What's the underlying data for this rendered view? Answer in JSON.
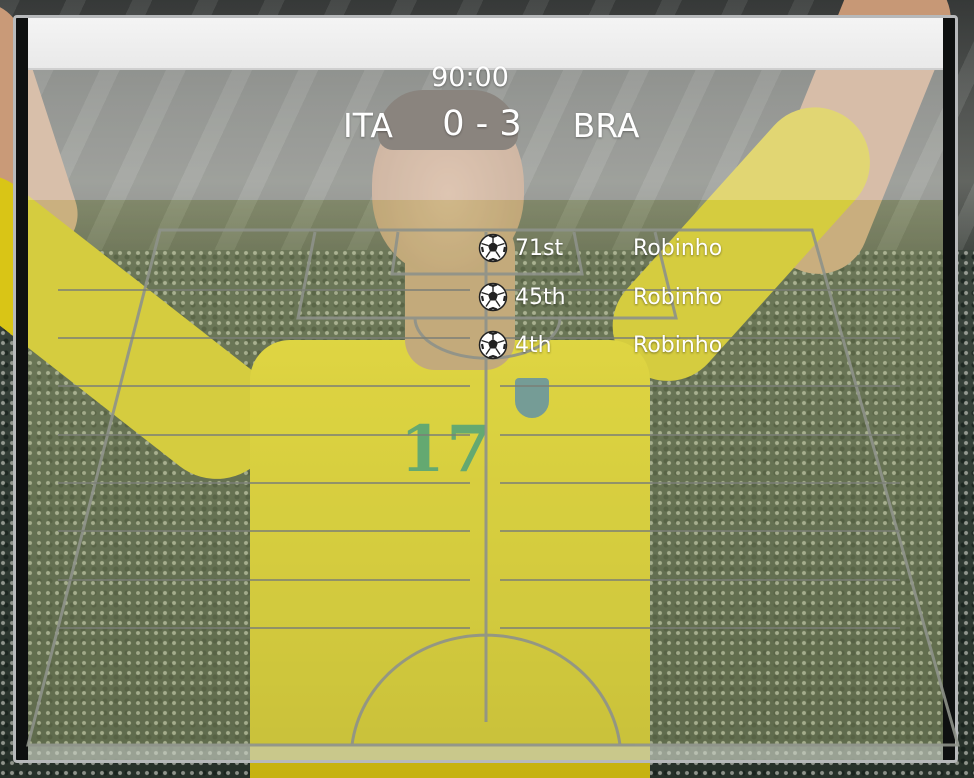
{
  "match": {
    "clock": "90:00",
    "home_team": "ITA",
    "away_team": "BRA",
    "score": "0 - 3"
  },
  "goals": [
    {
      "minute": "71st",
      "scorer": "Robinho",
      "icon": "soccer-ball-icon"
    },
    {
      "minute": "45th",
      "scorer": "Robinho",
      "icon": "soccer-ball-icon"
    },
    {
      "minute": "4th",
      "scorer": "Robinho",
      "icon": "soccer-ball-icon"
    }
  ],
  "scene": {
    "shirt_number": "17"
  },
  "colors": {
    "text": "#ffffff",
    "title_bar": "#f0f0f0",
    "pitch_lines": "#8a8f86",
    "shirt": "#d9c516"
  }
}
